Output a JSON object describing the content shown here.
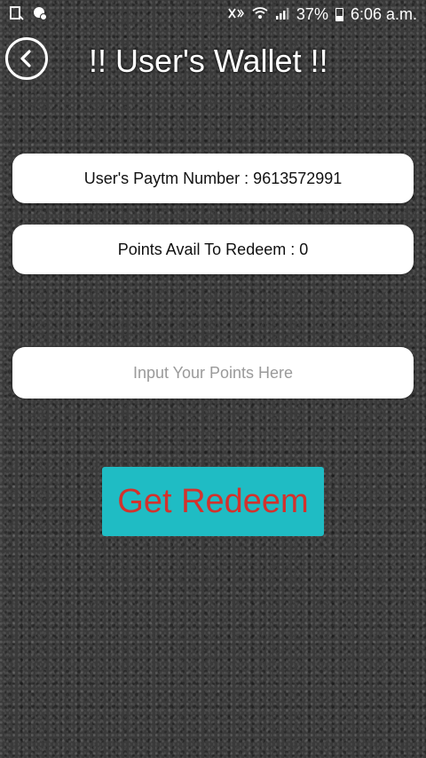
{
  "status_bar": {
    "left_icons": [
      "screen-record-icon",
      "notification-icon"
    ],
    "right_icons": [
      "mute-icon",
      "wifi-icon",
      "signal-icon"
    ],
    "battery_percent": "37%",
    "battery_level": 0.37,
    "time": "6:06 a.m."
  },
  "header": {
    "back_icon": "chevron-left-icon",
    "title": "!! User's Wallet !!"
  },
  "wallet": {
    "paytm_number_text": "User's Paytm Number : 9613572991",
    "points_avail_text": "Points Avail To Redeem : 0",
    "points_input_placeholder": "Input Your Points Here",
    "points_input_value": ""
  },
  "actions": {
    "redeem_label": "Get Redeem"
  },
  "colors": {
    "button_bg": "#1fbcc4",
    "button_text": "#d2322d",
    "card_bg": "#ffffff"
  }
}
